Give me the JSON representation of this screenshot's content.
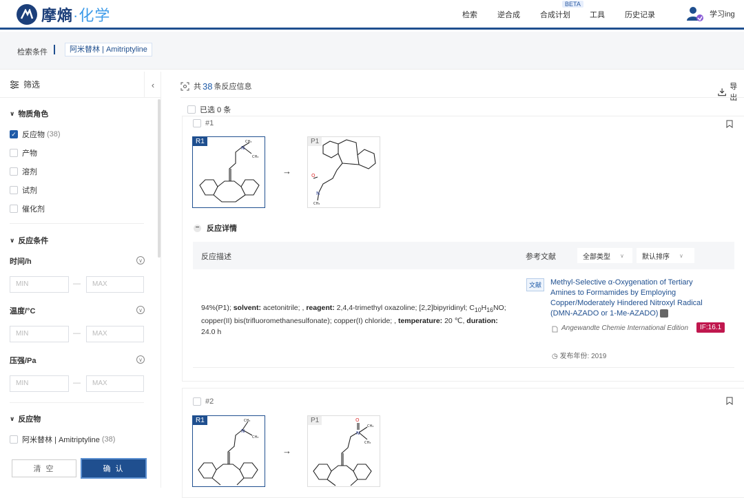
{
  "app": {
    "logo_main": "摩熵",
    "logo_dot": "·",
    "logo_sub": "化学"
  },
  "nav": [
    {
      "label": "检索"
    },
    {
      "label": "逆合成"
    },
    {
      "label": "合成计划"
    },
    {
      "label": "工具"
    },
    {
      "label": "历史记录"
    }
  ],
  "nav_badge": "BETA",
  "user": {
    "name": "学习ing"
  },
  "breadcrumb": {
    "label": "检索条件",
    "query": "阿米替林 | Amitriptyline"
  },
  "sidebar": {
    "title": "筛选",
    "role_section": "物质角色",
    "roles": [
      {
        "label": "反应物",
        "count": "(38)",
        "checked": true
      },
      {
        "label": "产物"
      },
      {
        "label": "溶剂"
      },
      {
        "label": "试剂"
      },
      {
        "label": "催化剂"
      }
    ],
    "cond_section": "反应条件",
    "conditions": [
      {
        "label": "时间/h",
        "min": "MIN",
        "max": "MAX"
      },
      {
        "label": "温度/°C",
        "min": "MIN",
        "max": "MAX"
      },
      {
        "label": "压强/Pa",
        "min": "MIN",
        "max": "MAX"
      }
    ],
    "reactant_section": "反应物",
    "reactant_item": {
      "label": "阿米替林 | Amitriptyline",
      "count": "(38)"
    },
    "clear_label": "清 空",
    "confirm_label": "确 认"
  },
  "results": {
    "prefix": "共",
    "count": "38",
    "suffix": "条反应信息",
    "export_label": "导出",
    "selected_label": "已选 0 条"
  },
  "reactions": [
    {
      "id": "#1",
      "reactant_tag": "R1",
      "product_tag": "P1"
    },
    {
      "id": "#2",
      "reactant_tag": "R1",
      "product_tag": "P1"
    }
  ],
  "detail": {
    "toggle_label": "反应详情",
    "col_desc": "反应描述",
    "col_ref": "参考文献",
    "filter_type": "全部类型",
    "filter_sort": "默认排序",
    "desc_yield": "94%(P1); ",
    "desc_solvent_k": "solvent:",
    "desc_solvent_v": " acetonitrile; , ",
    "desc_reagent_k": "reagent:",
    "desc_reagent_v": " 2,4,4-trimethyl oxazoline; [2,2]bipyridinyl;",
    "desc_formula_c": "C",
    "desc_formula_c_sub": "10",
    "desc_formula_h": "H",
    "desc_formula_h_sub": "16",
    "desc_formula_rest": "NO; copper(II) bis(trifluoromethanesulfonate); copper(I) chloride; , ",
    "desc_temp_k": "temperature:",
    "desc_temp_v": " 20 ℃, ",
    "desc_dur_k": "duration:",
    "desc_dur_v": " 24.0 h",
    "lit_badge": "文献",
    "lit_title": "Methyl-Selective α-Oxygenation of Tertiary Amines to Formamides by Employing Copper/Moderately Hindered Nitroxyl Radical (DMN-AZADO or 1-Me-AZADO)",
    "journal": "Angewandte Chemie International Edition",
    "impact": "IF:16.1",
    "year_label": "发布年份:",
    "year": "2019"
  },
  "atoms": {
    "n": "N",
    "o": "O",
    "ch3": "CH₃"
  },
  "colors": {
    "brand": "#1f4f8f",
    "accent": "#3d9be9",
    "impact": "#c0174e"
  }
}
